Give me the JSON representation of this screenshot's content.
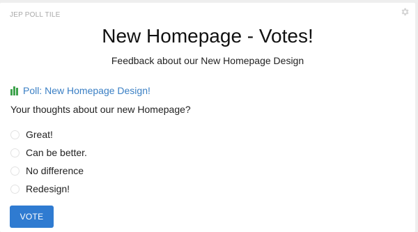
{
  "tile": {
    "label": "JEP POLL TILE",
    "settings_icon": "gear-icon"
  },
  "header": {
    "title": "New Homepage - Votes!",
    "subtitle": "Feedback about our New Homepage Design"
  },
  "poll": {
    "icon": "bar-chart-icon",
    "title": "Poll: New Homepage Design!",
    "question": "Your thoughts about our new Homepage?",
    "options": [
      {
        "label": "Great!",
        "selected": false
      },
      {
        "label": "Can be better.",
        "selected": false
      },
      {
        "label": "No difference",
        "selected": false
      },
      {
        "label": "Redesign!",
        "selected": false
      }
    ],
    "vote_label": "VOTE"
  },
  "colors": {
    "accent": "#2f7bd1",
    "poll_title": "#3a7fc4",
    "poll_icon": "#3fa34d",
    "tile_label": "#a8a8a8"
  }
}
